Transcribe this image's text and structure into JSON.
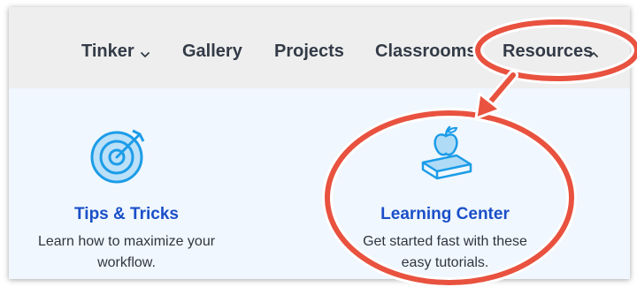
{
  "nav": {
    "tinker": "Tinker",
    "gallery": "Gallery",
    "projects": "Projects",
    "classrooms": "Classrooms",
    "resources": "Resources"
  },
  "menu": {
    "tips": {
      "title": "Tips & Tricks",
      "desc_line1": "Learn how to maximize your",
      "desc_line2": "workflow."
    },
    "learning": {
      "title": "Learning Center",
      "desc_line1": "Get started fast with these",
      "desc_line2": "easy tutorials."
    }
  },
  "colors": {
    "accent_link": "#1a4fc8",
    "icon_blue": "#1c9ce8",
    "annotation_red": "#e8523f"
  },
  "icons": [
    "target-icon",
    "apple-book-icon",
    "chevron-down-icon",
    "chevron-up-icon"
  ]
}
